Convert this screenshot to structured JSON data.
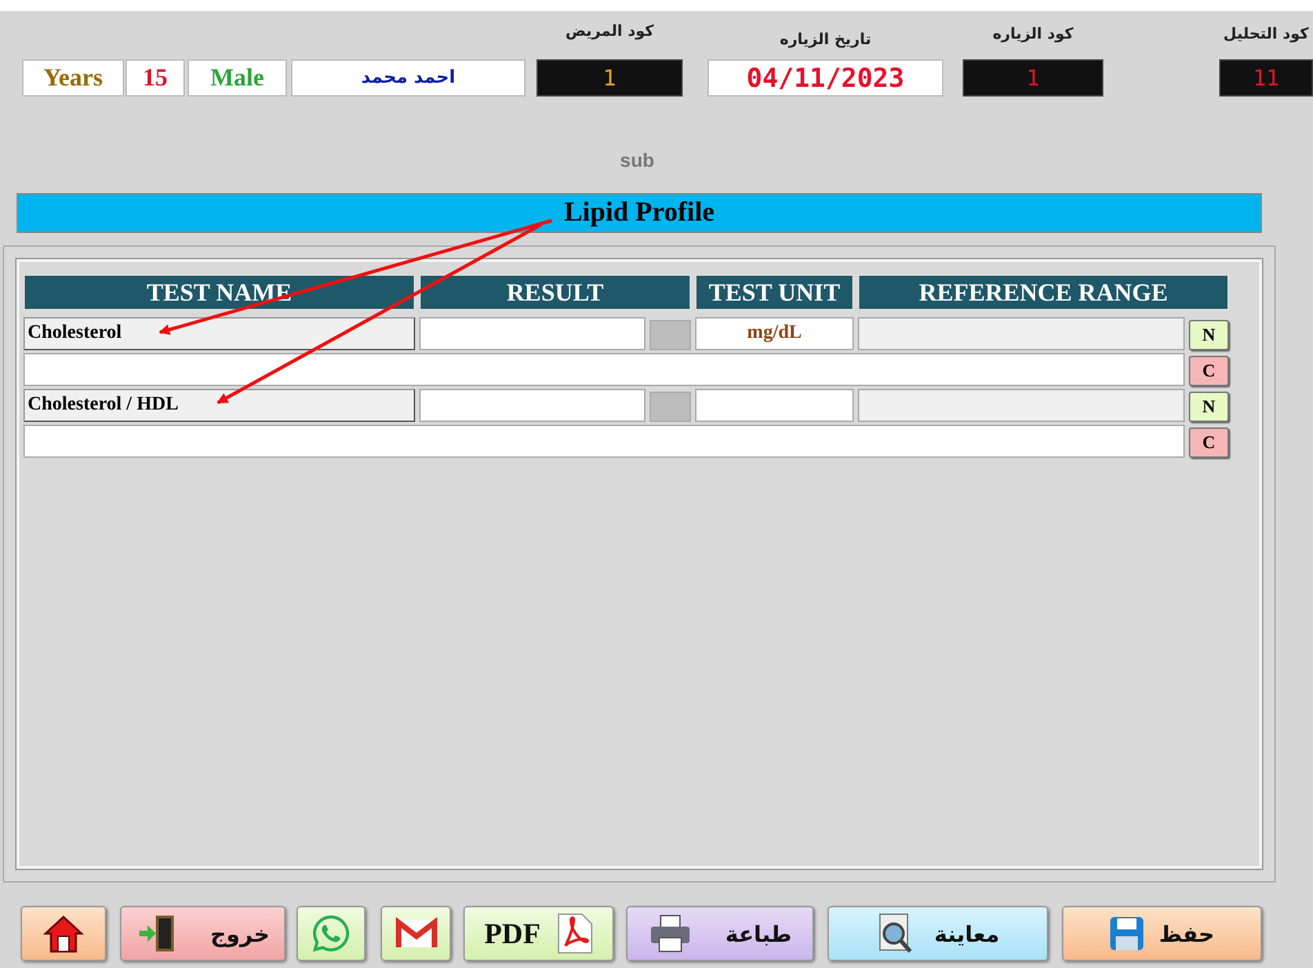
{
  "patient": {
    "age_unit": "Years",
    "age": "15",
    "gender": "Male",
    "name": "احمد محمد"
  },
  "codes": [
    {
      "kind": "code",
      "label": "كود التحليل",
      "value": "11",
      "color": "#e8102a"
    },
    {
      "kind": "code",
      "label": "كود الزياره",
      "value": "1",
      "color": "#e8102a"
    },
    {
      "kind": "date",
      "label": "تاريخ الزياره",
      "value": "04/11/2023",
      "color": "#e8102a"
    },
    {
      "kind": "code",
      "label": "كود المريض",
      "value": "1",
      "color": "#e8a317"
    }
  ],
  "sub": "sub",
  "group_title": "Lipid Profile",
  "table": {
    "columns": [
      "REFERENCE RANGE",
      "TEST UNIT",
      "RESULT",
      "TEST NAME"
    ],
    "rows": [
      {
        "name": "Cholesterol",
        "unit": "mg/dL",
        "normal_button": "N",
        "comment_button": "C"
      },
      {
        "name": "Cholesterol / HDL",
        "normal_button": "N",
        "comment_button": "C"
      }
    ]
  },
  "buttons": [
    {
      "kind": "save",
      "label": "حفظ"
    },
    {
      "kind": "preview",
      "label": "معاينة"
    },
    {
      "kind": "print",
      "label": "طباعة"
    },
    {
      "kind": "pdf",
      "label": "PDF"
    },
    {
      "kind": "gmail"
    },
    {
      "kind": "whatsapp"
    },
    {
      "kind": "exit",
      "label": "خروج"
    },
    {
      "kind": "home"
    }
  ]
}
